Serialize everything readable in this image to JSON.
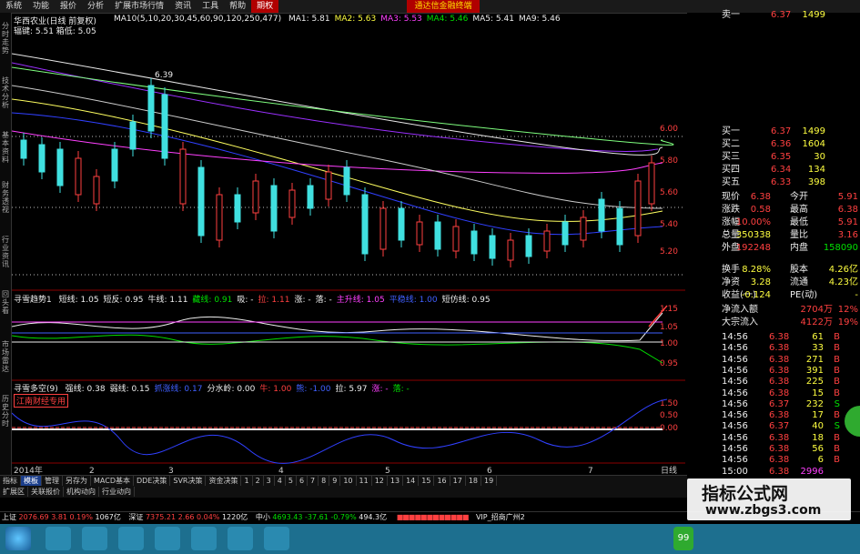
{
  "menu": [
    "系统",
    "功能",
    "报价",
    "分析",
    "扩展市场行情",
    "资讯",
    "工具",
    "帮助",
    "期权"
  ],
  "menu_active": 8,
  "menu_warn": "通达信金融终端",
  "title": "华西农业(日线 前复权)",
  "ma_legend": {
    "main": "MA10(5,10,20,30,45,60,90,120,250,477)",
    "items": [
      {
        "label": "MA1: 5.81",
        "color": "#eeeeee"
      },
      {
        "label": "MA2: 5.63",
        "color": "#ffff40"
      },
      {
        "label": "MA3: 5.53",
        "color": "#ff40ff"
      },
      {
        "label": "MA4: 5.46",
        "color": "#00e000"
      },
      {
        "label": "MA5: 5.41",
        "color": "#eeeeee"
      },
      {
        "label": "MA9: 5.46",
        "color": "#eeeeee"
      }
    ]
  },
  "sub_legend": "辐键: 5.51  箱低: 5.05",
  "high_marker": "6.39",
  "left_tabs": [
    "分时走势",
    "技术分析",
    "基本资料",
    "财务透视",
    "行业资讯",
    "回头看",
    "市场雷达",
    "历史分时"
  ],
  "price_axis": [
    "6.00",
    "5.80",
    "5.60",
    "5.40",
    "5.20"
  ],
  "ind1_legend": {
    "name": "寻雪趋势1",
    "items": [
      {
        "label": "短线: 1.05",
        "color": "#eeeeee"
      },
      {
        "label": "短反: 0.95",
        "color": "#eeeeee"
      },
      {
        "label": "牛线: 1.11",
        "color": "#eeeeee"
      },
      {
        "label": "藏线: 0.91",
        "color": "#00e000"
      },
      {
        "label": "吸: -",
        "color": "#eeeeee"
      },
      {
        "label": "拉: 1.11",
        "color": "#ff4040"
      },
      {
        "label": "涨: -",
        "color": "#eeeeee"
      },
      {
        "label": "落: -",
        "color": "#eeeeee"
      },
      {
        "label": "主升线: 1.05",
        "color": "#ff40ff"
      },
      {
        "label": "平稳线: 1.00",
        "color": "#4060ff"
      },
      {
        "label": "短仿线: 0.95",
        "color": "#eeeeee"
      }
    ]
  },
  "ind1_axis": [
    "1.15",
    "1.05",
    "1.00",
    "0.95"
  ],
  "ind2_legend": {
    "name": "寻雪多空(9)",
    "items": [
      {
        "label": "强线: 0.38",
        "color": "#eeeeee"
      },
      {
        "label": "弱线: 0.15",
        "color": "#eeeeee"
      },
      {
        "label": "抓涨线: 0.17",
        "color": "#4060ff"
      },
      {
        "label": "分水岭: 0.00",
        "color": "#eeeeee"
      },
      {
        "label": "牛: 1.00",
        "color": "#ff4040"
      },
      {
        "label": "熊: -1.00",
        "color": "#4060ff"
      },
      {
        "label": "拉: 5.97",
        "color": "#eeeeee"
      },
      {
        "label": "涨: -",
        "color": "#ff40ff"
      },
      {
        "label": "落: -",
        "color": "#00e000"
      }
    ],
    "badge": "江南财经专用"
  },
  "ind2_axis": [
    "1.50",
    "0.50",
    "0.00"
  ],
  "x_axis": [
    "2014年",
    "2",
    "3",
    "4",
    "5",
    "6",
    "7"
  ],
  "x_axis_right": "日线",
  "quote": {
    "ask": [
      {
        "label": "卖一",
        "price": "6.37",
        "vol": "1499"
      },
      {
        "label": "买一",
        "price": "6.37",
        "vol": "1499"
      },
      {
        "label": "买二",
        "price": "6.36",
        "vol": "1604"
      },
      {
        "label": "买三",
        "price": "6.35",
        "vol": "30"
      },
      {
        "label": "买四",
        "price": "6.34",
        "vol": "134"
      },
      {
        "label": "买五",
        "price": "6.33",
        "vol": "398"
      }
    ],
    "stats": [
      {
        "l1": "现价",
        "v1": "6.38",
        "c1": "red",
        "l2": "今开",
        "v2": "5.91",
        "c2": "red"
      },
      {
        "l1": "涨跌",
        "v1": "0.58",
        "c1": "red",
        "l2": "最高",
        "v2": "6.38",
        "c2": "red"
      },
      {
        "l1": "涨幅",
        "v1": "10.00%",
        "c1": "red",
        "l2": "最低",
        "v2": "5.91",
        "c2": "red"
      },
      {
        "l1": "总量",
        "v1": "350338",
        "c1": "yellow",
        "l2": "量比",
        "v2": "3.16",
        "c2": "red"
      },
      {
        "l1": "外盘",
        "v1": "192248",
        "c1": "red",
        "l2": "内盘",
        "v2": "158090",
        "c2": "green"
      }
    ],
    "fin": [
      {
        "l1": "换手",
        "v1": "8.28%",
        "l2": "股本",
        "v2": "4.26亿"
      },
      {
        "l1": "净资",
        "v1": "3.28",
        "l2": "流通",
        "v2": "4.23亿"
      },
      {
        "l1": "收益(一)",
        "v1": "-0.124",
        "l2": "PE(动)",
        "v2": "-"
      }
    ],
    "flow": [
      {
        "label": "净流入额",
        "value": "2704万",
        "pct": "12%"
      },
      {
        "label": "大宗流入",
        "value": "4122万",
        "pct": "19%"
      }
    ],
    "ticks": [
      {
        "time": "14:56",
        "price": "6.38",
        "vol": "61",
        "bs": "B"
      },
      {
        "time": "14:56",
        "price": "6.38",
        "vol": "33",
        "bs": "B"
      },
      {
        "time": "14:56",
        "price": "6.38",
        "vol": "271",
        "bs": "B"
      },
      {
        "time": "14:56",
        "price": "6.38",
        "vol": "391",
        "bs": "B"
      },
      {
        "time": "14:56",
        "price": "6.38",
        "vol": "225",
        "bs": "B"
      },
      {
        "time": "14:56",
        "price": "6.38",
        "vol": "15",
        "bs": "B"
      },
      {
        "time": "14:56",
        "price": "6.37",
        "vol": "232",
        "bs": "S"
      },
      {
        "time": "14:56",
        "price": "6.38",
        "vol": "17",
        "bs": "B"
      },
      {
        "time": "14:56",
        "price": "6.37",
        "vol": "40",
        "bs": "S"
      },
      {
        "time": "14:56",
        "price": "6.38",
        "vol": "18",
        "bs": "B"
      },
      {
        "time": "14:56",
        "price": "6.38",
        "vol": "56",
        "bs": "B"
      },
      {
        "time": "14:56",
        "price": "6.38",
        "vol": "6",
        "bs": "B"
      },
      {
        "time": "15:00",
        "price": "6.38",
        "vol": "2996",
        "bs": ""
      }
    ]
  },
  "toolbar_row1": [
    "指标",
    "模板",
    "管理",
    "另存为",
    "MACD基本",
    "DDE决策",
    "SVR决策",
    "资金决策",
    "1",
    "2",
    "3",
    "4",
    "5",
    "6",
    "7",
    "8",
    "9",
    "10",
    "11",
    "12",
    "13",
    "14",
    "15",
    "16",
    "17",
    "18",
    "19"
  ],
  "toolbar_row1_selected": 1,
  "toolbar_row2": [
    "扩展区",
    "关联报价",
    "机构动向",
    "行业动向"
  ],
  "status": {
    "sh_label": "上证",
    "sh_val": "2076.69",
    "sh_chg": "3.81",
    "sh_pct": "0.19%",
    "sh_amt": "1067亿",
    "sz_label": "深证",
    "sz_val": "7375.21",
    "sz_chg": "2.66",
    "sz_pct": "0.04%",
    "sz_amt": "1220亿",
    "zx_label": "中小",
    "zx_val": "4693.43",
    "zx_chg": "-37.61",
    "zx_pct": "-0.79%",
    "zx_amt": "494.3亿",
    "vip": "VIP_招商广州2"
  },
  "watermark": {
    "title": "指标公式网",
    "url": "www.zbgs3.com"
  },
  "tray_badge": "99"
}
